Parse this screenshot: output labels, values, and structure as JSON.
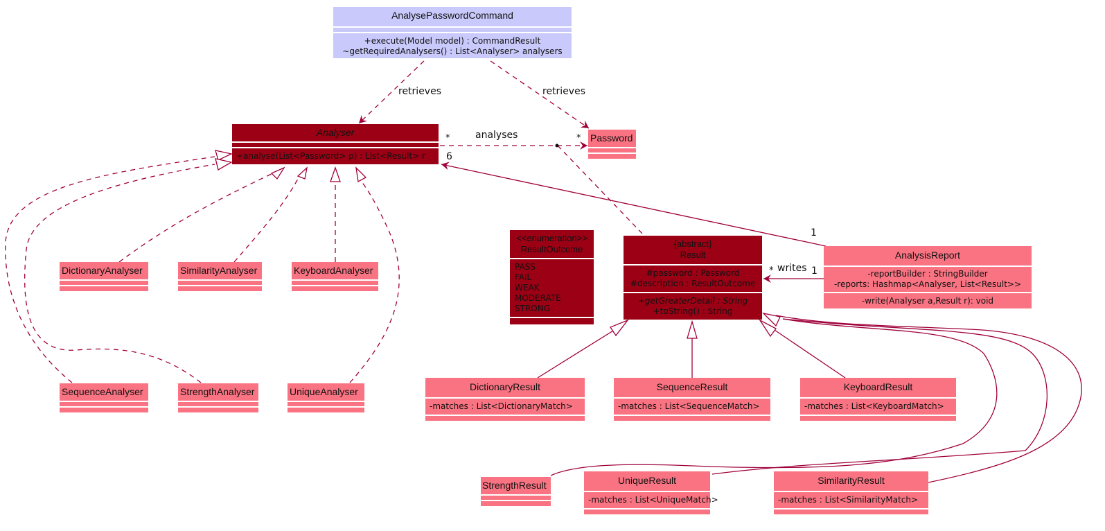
{
  "diagram": {
    "type": "UML class diagram",
    "colors": {
      "command_fill": "#c9c9fb",
      "abstract_fill": "#9b0015",
      "concrete_fill": "#f97382",
      "edge": "#a0003a"
    },
    "classes": {
      "analyse_password_command": {
        "name": "AnalysePasswordCommand",
        "methods": [
          "+execute(Model model) : CommandResult",
          "~getRequiredAnalysers() : List<Analyser> analysers"
        ]
      },
      "analyser": {
        "name": "Analyser",
        "methods": [
          "+analyse(List<Password> p) : List<Result> r"
        ]
      },
      "password": {
        "name": "Password"
      },
      "result_outcome": {
        "stereotype": "<<enumeration>>",
        "name": "ResultOutcome",
        "values": [
          "PASS",
          "FAIL",
          "WEAK",
          "MODERATE",
          "STRONG"
        ]
      },
      "result": {
        "stereotype": "{abstract}",
        "name": "Result",
        "attributes": [
          "#password : Password",
          "#description : ResultOutcome"
        ],
        "methods": [
          "+getGreaterDetail : String",
          "+toString() : String"
        ]
      },
      "analysis_report": {
        "name": "AnalysisReport",
        "attributes": [
          "-reportBuilder : StringBuilder",
          "-reports: Hashmap<Analyser, List<Result>>"
        ],
        "methods": [
          "-write(Analyser a,Result r): void"
        ]
      },
      "dictionary_analyser": {
        "name": "DictionaryAnalyser"
      },
      "similarity_analyser": {
        "name": "SimilarityAnalyser"
      },
      "keyboard_analyser": {
        "name": "KeyboardAnalyser"
      },
      "sequence_analyser": {
        "name": "SequenceAnalyser"
      },
      "strength_analyser": {
        "name": "StrengthAnalyser"
      },
      "unique_analyser": {
        "name": "UniqueAnalyser"
      },
      "dictionary_result": {
        "name": "DictionaryResult",
        "attributes": [
          "-matches : List<DictionaryMatch>"
        ]
      },
      "sequence_result": {
        "name": "SequenceResult",
        "attributes": [
          "-matches : List<SequenceMatch>"
        ]
      },
      "keyboard_result": {
        "name": "KeyboardResult",
        "attributes": [
          "-matches : List<KeyboardMatch>"
        ]
      },
      "strength_result": {
        "name": "StrengthResult"
      },
      "unique_result": {
        "name": "UniqueResult",
        "attributes": [
          "-matches : List<UniqueMatch>"
        ]
      },
      "similarity_result": {
        "name": "SimilarityResult",
        "attributes": [
          "-matches : List<SimilarityMatch>"
        ]
      }
    },
    "relations": {
      "retrieves_left": "retrieves",
      "retrieves_right": "retrieves",
      "analyses": "analyses",
      "analyses_mult_src": "*",
      "analyses_mult_dst": "*",
      "writes": "writes",
      "writes_mult_src": "1",
      "writes_mult_dst": "*",
      "report_to_analyser_src": "1",
      "report_to_analyser_dst": "6"
    }
  }
}
